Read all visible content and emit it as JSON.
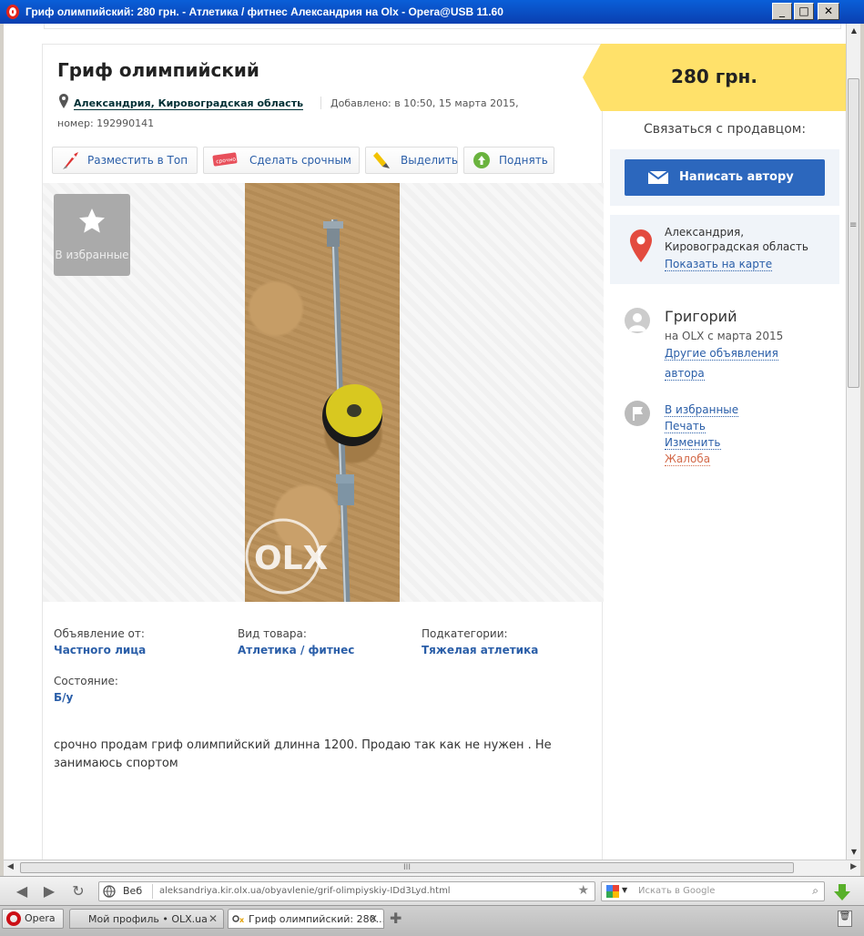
{
  "window": {
    "title": "Гриф олимпийский: 280 грн. - Атлетика / фитнес Александрия на Olx - Opera@USB 11.60"
  },
  "listing": {
    "title": "Гриф олимпийский",
    "location": "Александрия, Кировоградская область",
    "added": "Добавлено: в 10:50, 15 марта 2015,",
    "number": "номер: 192990141",
    "promo": [
      {
        "label": "Разместить в Топ",
        "icon": "rocket-icon"
      },
      {
        "label": "Сделать срочным",
        "icon": "urgent-tag-icon"
      },
      {
        "label": "Выделить",
        "icon": "highlighter-icon"
      },
      {
        "label": "Поднять",
        "icon": "refresh-arrow-icon"
      }
    ],
    "favorite_label": "В избранные",
    "details": [
      {
        "label": "Объявление от:",
        "value": "Частного лица"
      },
      {
        "label": "Вид товара:",
        "value": "Атлетика / фитнес"
      },
      {
        "label": "Подкатегории:",
        "value": "Тяжелая атлетика"
      },
      {
        "label": "Состояние:",
        "value": "Б/у"
      }
    ],
    "description_line1": "срочно продам гриф олимпийский длинна 1200. Продаю так как не нужен . Не",
    "description_line2": "занимаюсь спортом",
    "photo_watermark": "OLX"
  },
  "sidebar": {
    "price": "280 грн.",
    "contact_title": "Связаться с продавцом:",
    "message_button": "Написать автору",
    "location_line1": "Александрия,",
    "location_line2": "Кировоградская область",
    "map_link": "Показать на карте",
    "seller_name": "Григорий",
    "seller_since": "на OLX с марта 2015",
    "other_ads_line1": "Другие объявления",
    "other_ads_line2": "автора",
    "actions": [
      "В избранные",
      "Печать",
      "Изменить",
      "Жалоба"
    ]
  },
  "browser": {
    "web_label": "Веб",
    "url": "aleksandriya.kir.olx.ua/obyavlenie/grif-olimpiyskiy-IDd3Lyd.html",
    "search_placeholder": "Искать в Google",
    "opera_button": "Opera",
    "tabs": [
      "Мой профиль • OLX.ua",
      "Гриф олимпийский: 280..."
    ],
    "h_scroll_grip": "III"
  },
  "colors": {
    "link": "#2a5ea8",
    "price_tag": "#ffe16a",
    "button": "#2c67bd",
    "complaint": "#d36a4a",
    "pin": "#e34b3f"
  }
}
